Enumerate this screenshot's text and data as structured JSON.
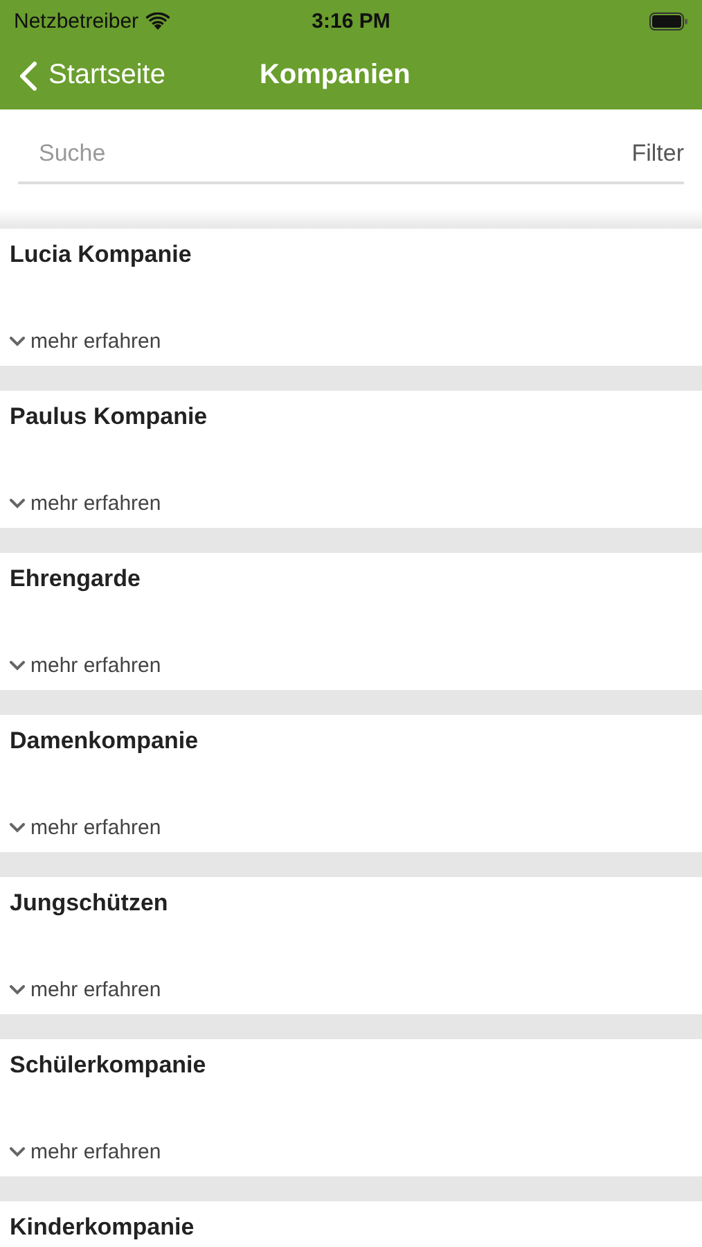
{
  "status_bar": {
    "carrier": "Netzbetreiber",
    "time": "3:16 PM"
  },
  "nav": {
    "back": "Startseite",
    "title": "Kompanien"
  },
  "search": {
    "placeholder": "Suche",
    "filter": "Filter"
  },
  "companies": [
    {
      "name": "Lucia Kompanie",
      "more": "mehr erfahren"
    },
    {
      "name": "Paulus Kompanie",
      "more": "mehr erfahren"
    },
    {
      "name": "Ehrengarde",
      "more": "mehr erfahren"
    },
    {
      "name": "Damenkompanie",
      "more": "mehr erfahren"
    },
    {
      "name": "Jungschützen",
      "more": "mehr erfahren"
    },
    {
      "name": "Schülerkompanie",
      "more": "mehr erfahren"
    },
    {
      "name": "Kinderkompanie"
    }
  ]
}
